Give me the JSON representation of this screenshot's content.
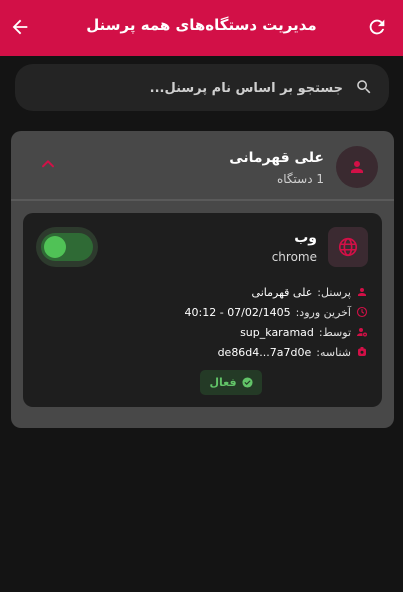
{
  "header": {
    "title": "مدیریت دستگاه‌های همه پرسنل"
  },
  "search": {
    "placeholder": "جستجو بر اساس نام پرسنل..."
  },
  "group": {
    "name": "علی قهرمانی",
    "device_count": "1 دستگاه",
    "device": {
      "type": "وب",
      "browser": "chrome",
      "toggle_on": true,
      "details": [
        {
          "label": "پرسنل:",
          "value": "علی قهرمانی",
          "icon": "person-icon"
        },
        {
          "label": "آخرین ورود:",
          "value": "07/02/1405 - 40:12",
          "icon": "clock-icon"
        },
        {
          "label": "توسط:",
          "value": "sup_karamad",
          "icon": "admin-icon"
        },
        {
          "label": "شناسه:",
          "value": "de86d4...7a7d0e",
          "icon": "id-icon"
        }
      ],
      "status": "فعال"
    }
  },
  "colors": {
    "brand": "#d21047",
    "active": "#50c256",
    "background": "#141414"
  }
}
